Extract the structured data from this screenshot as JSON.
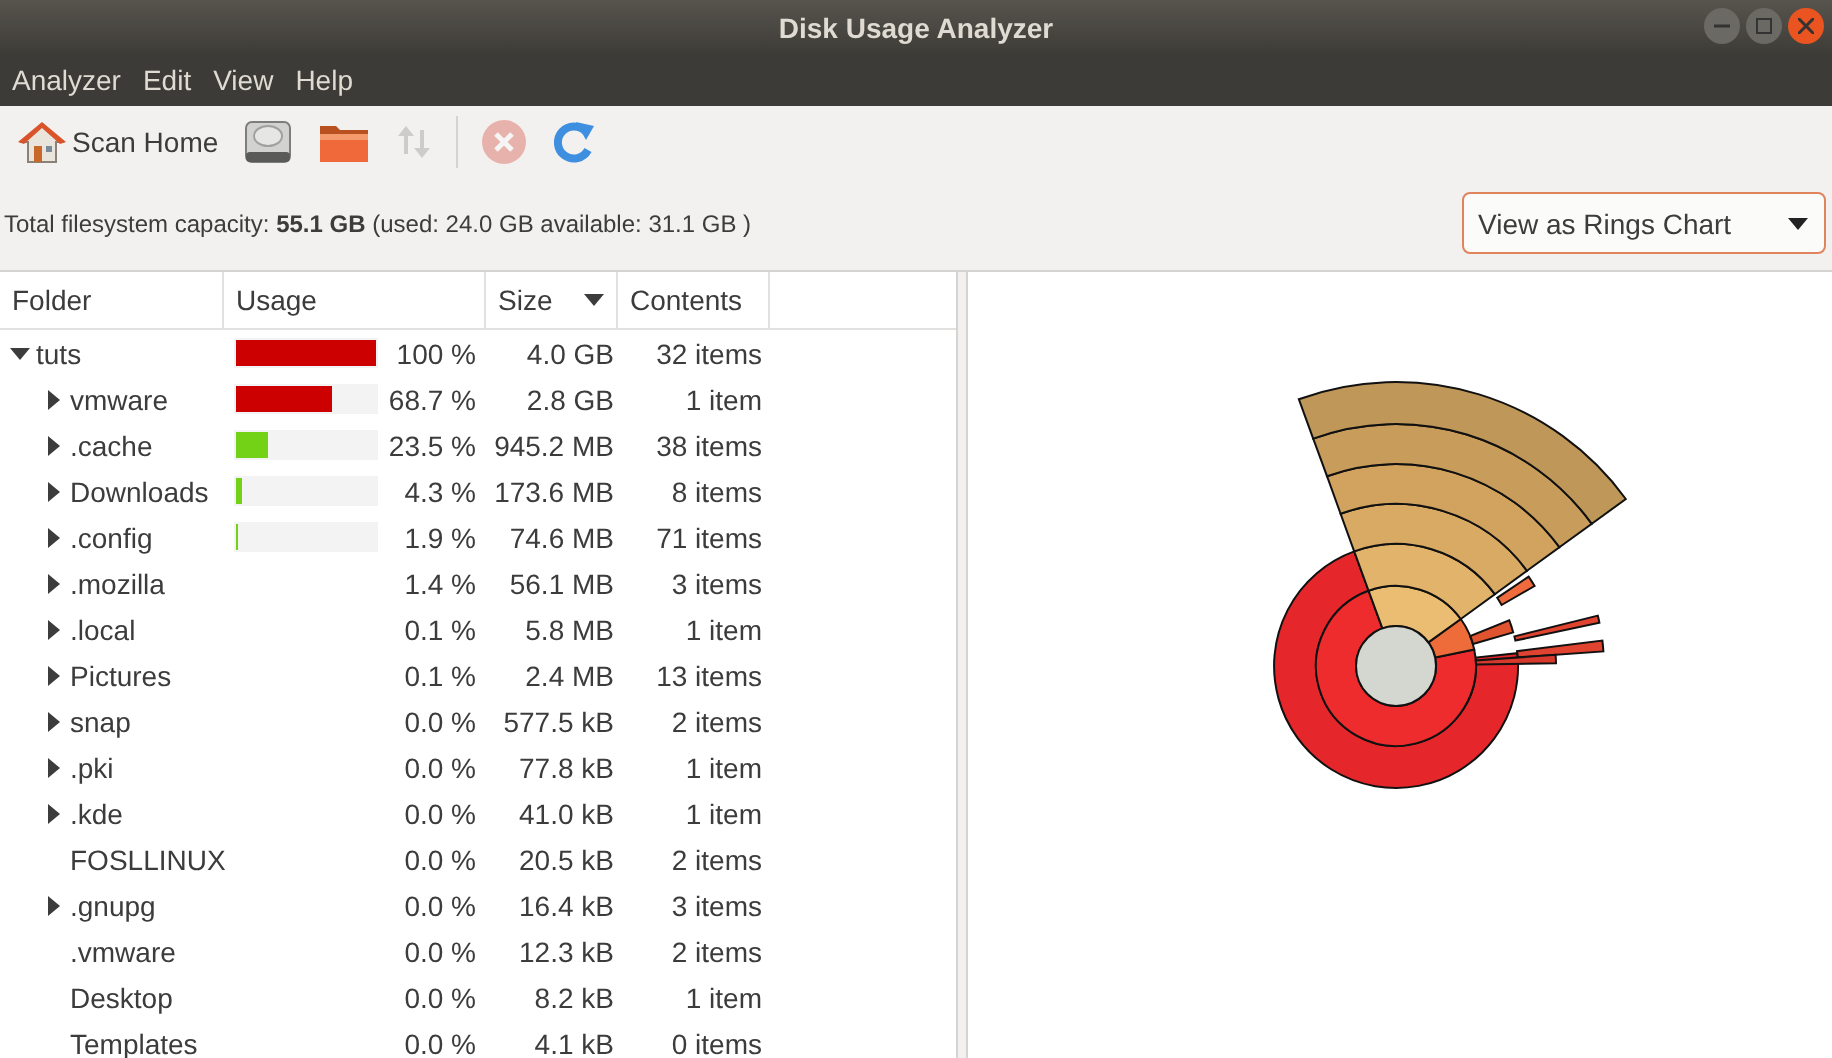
{
  "window": {
    "title": "Disk Usage Analyzer"
  },
  "menu": [
    "Analyzer",
    "Edit",
    "View",
    "Help"
  ],
  "toolbar": [
    {
      "kind": "home",
      "label": "Scan Home",
      "disabled": false
    },
    {
      "kind": "disk",
      "disabled": false
    },
    {
      "kind": "folder",
      "disabled": false
    },
    {
      "kind": "sort",
      "disabled": true
    },
    {
      "kind": "stop",
      "disabled": true
    },
    {
      "kind": "refresh",
      "disabled": false
    }
  ],
  "capacity": {
    "label": "Total filesystem capacity:",
    "total": "55.1 GB",
    "detail": "(used: 24.0 GB available: 31.1 GB )"
  },
  "view_selector": {
    "value": "View as Rings Chart"
  },
  "table": {
    "columns": [
      {
        "label": "Folder",
        "sorted": false
      },
      {
        "label": "Usage",
        "sorted": false
      },
      {
        "label": "Size",
        "sorted": true
      },
      {
        "label": "Contents",
        "sorted": false
      }
    ],
    "rows": [
      {
        "name": "tuts",
        "expanded": true,
        "usage": {
          "level": 1,
          "color": "#cc0000"
        },
        "percent": "100 %",
        "size": "4.0 GB",
        "contents": "32 items",
        "children": [
          {
            "name": "vmware",
            "expanded": false,
            "usage": {
              "level": 0.687,
              "color": "#cc0000"
            },
            "percent": "68.7 %",
            "size": "2.8 GB",
            "contents": "1 item"
          },
          {
            "name": ".cache",
            "expanded": false,
            "usage": {
              "level": 0.235,
              "color": "#73d216"
            },
            "percent": "23.5 %",
            "size": "945.2 MB",
            "contents": "38 items"
          },
          {
            "name": "Downloads",
            "expanded": false,
            "usage": {
              "level": 0.043,
              "color": "#73d216"
            },
            "percent": "4.3 %",
            "size": "173.6 MB",
            "contents": "8 items"
          },
          {
            "name": ".config",
            "expanded": false,
            "usage": {
              "level": 0.019,
              "color": "#73d216"
            },
            "percent": "1.9 %",
            "size": "74.6 MB",
            "contents": "71 items"
          },
          {
            "name": ".mozilla",
            "expanded": false,
            "percent": "1.4 %",
            "size": "56.1 MB",
            "contents": "3 items"
          },
          {
            "name": ".local",
            "expanded": false,
            "percent": "0.1 %",
            "size": "5.8 MB",
            "contents": "1 item"
          },
          {
            "name": "Pictures",
            "expanded": false,
            "percent": "0.1 %",
            "size": "2.4 MB",
            "contents": "13 items"
          },
          {
            "name": "snap",
            "expanded": false,
            "percent": "0.0 %",
            "size": "577.5 kB",
            "contents": "2 items"
          },
          {
            "name": ".pki",
            "expanded": false,
            "percent": "0.0 %",
            "size": "77.8 kB",
            "contents": "1 item"
          },
          {
            "name": ".kde",
            "expanded": false,
            "percent": "0.0 %",
            "size": "41.0 kB",
            "contents": "1 item"
          },
          {
            "name": "FOSLLINUX",
            "percent": "0.0 %",
            "size": "20.5 kB",
            "contents": "2 items"
          },
          {
            "name": ".gnupg",
            "expanded": false,
            "percent": "0.0 %",
            "size": "16.4 kB",
            "contents": "3 items"
          },
          {
            "name": ".vmware",
            "percent": "0.0 %",
            "size": "12.3 kB",
            "contents": "2 items"
          },
          {
            "name": "Desktop",
            "percent": "0.0 %",
            "size": "8.2 kB",
            "contents": "1 item"
          },
          {
            "name": "Templates",
            "percent": "0.0 %",
            "size": "4.1 kB",
            "contents": "0 items"
          }
        ]
      }
    ]
  }
}
